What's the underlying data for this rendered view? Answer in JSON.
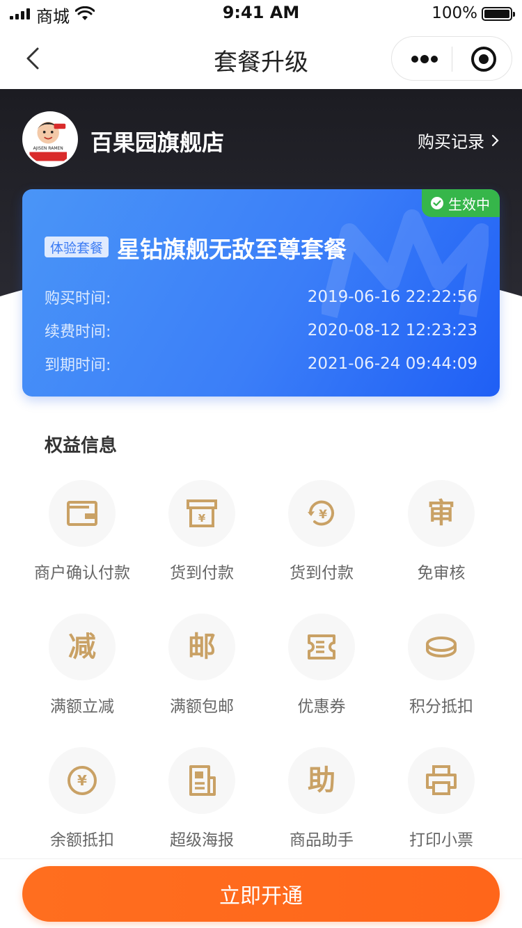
{
  "status_bar": {
    "carrier": "商城",
    "time": "9:41 AM",
    "battery": "100%"
  },
  "nav": {
    "title": "套餐升级"
  },
  "store": {
    "name": "百果园旗舰店",
    "records_link": "购买记录"
  },
  "plan": {
    "status_badge": "生效中",
    "trial_tag": "体验套餐",
    "name": "星钻旗舰无敌至尊套餐",
    "rows": [
      {
        "label": "购买时间:",
        "value": "2019-06-16 22:22:56"
      },
      {
        "label": "续费时间:",
        "value": "2020-08-12 12:23:23"
      },
      {
        "label": "到期时间:",
        "value": "2021-06-24 09:44:09"
      }
    ]
  },
  "benefits": {
    "title": "权益信息",
    "items": [
      {
        "label": "商户确认付款",
        "icon": "wallet-icon"
      },
      {
        "label": "货到付款",
        "icon": "yen-box-icon"
      },
      {
        "label": "货到付款",
        "icon": "yen-refresh-icon"
      },
      {
        "label": "免审核",
        "icon": "shen-glyph",
        "glyph": "审"
      },
      {
        "label": "满额立减",
        "icon": "jian-glyph",
        "glyph": "减"
      },
      {
        "label": "满额包邮",
        "icon": "you-glyph",
        "glyph": "邮"
      },
      {
        "label": "优惠券",
        "icon": "coupon-icon"
      },
      {
        "label": "积分抵扣",
        "icon": "coin-icon"
      },
      {
        "label": "余额抵扣",
        "icon": "yen-circle-icon"
      },
      {
        "label": "超级海报",
        "icon": "poster-icon"
      },
      {
        "label": "商品助手",
        "icon": "zhu-glyph",
        "glyph": "助"
      },
      {
        "label": "打印小票",
        "icon": "printer-icon"
      }
    ]
  },
  "bottom": {
    "cta": "立即开通"
  },
  "colors": {
    "accent_orange": "#ff661a",
    "card_blue": "#3b7ef8",
    "badge_green": "#36b64a",
    "icon_gold": "#c9a165",
    "header_dark": "#22222a"
  }
}
